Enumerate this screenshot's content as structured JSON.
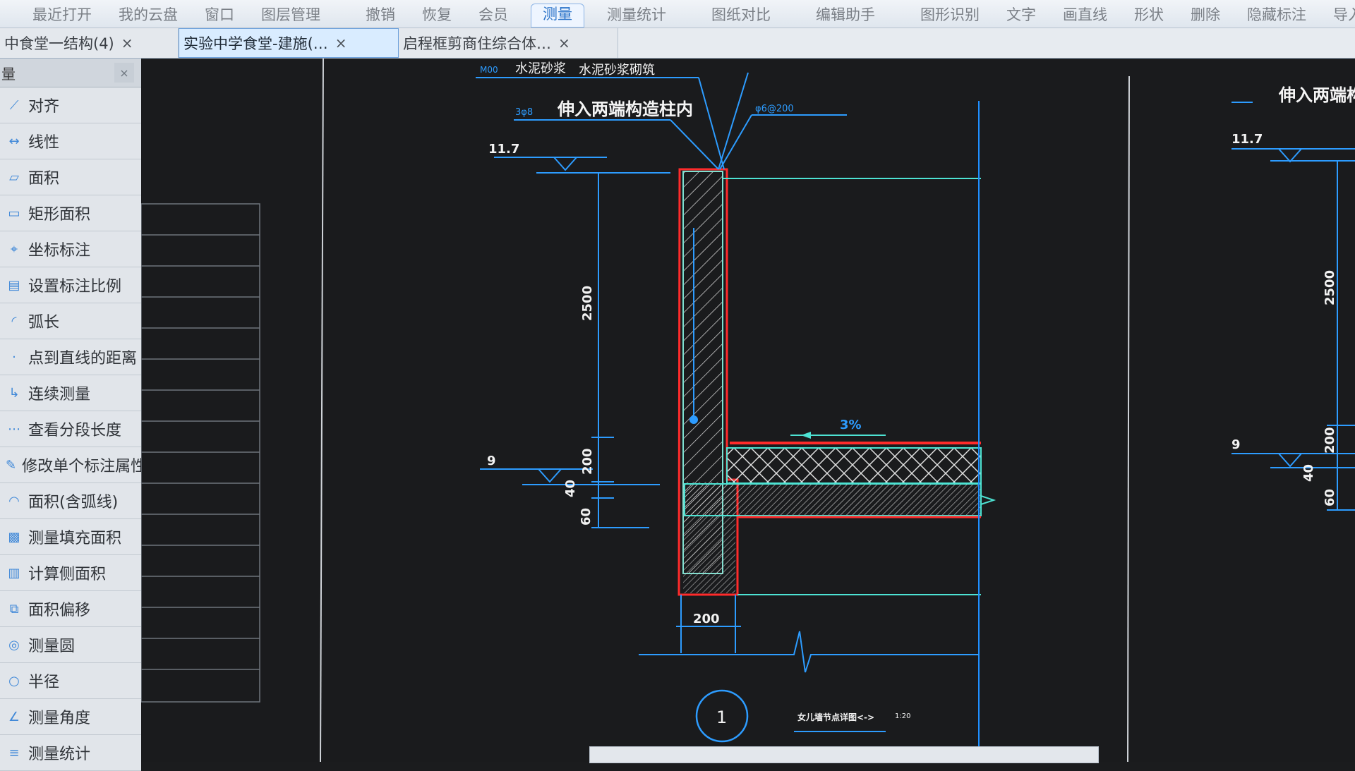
{
  "toolbar": {
    "items": [
      "最近打开",
      "我的云盘",
      "窗口",
      "图层管理",
      "撤销",
      "恢复",
      "会员",
      "测量",
      "测量统计",
      "图纸对比",
      "编辑助手",
      "图形识别",
      "文字",
      "画直线",
      "形状",
      "删除",
      "隐藏标注",
      "导入导"
    ],
    "active_index": 7
  },
  "tabs": [
    {
      "label": "中食堂一结构(4)",
      "close": "×"
    },
    {
      "label": "实验中学食堂-建施(…",
      "close": "×"
    },
    {
      "label": "启程框剪商住综合体…",
      "close": "×"
    }
  ],
  "active_tab": 1,
  "sidebar": {
    "title": "量",
    "close": "×",
    "items": [
      {
        "label": "对齐",
        "icon": "align-icon"
      },
      {
        "label": "线性",
        "icon": "linear-icon"
      },
      {
        "label": "面积",
        "icon": "area-icon"
      },
      {
        "label": "矩形面积",
        "icon": "rect-area-icon"
      },
      {
        "label": "坐标标注",
        "icon": "coordinate-icon"
      },
      {
        "label": "设置标注比例",
        "icon": "scale-icon"
      },
      {
        "label": "弧长",
        "icon": "arc-icon"
      },
      {
        "label": "点到直线的距离",
        "icon": "distance-icon"
      },
      {
        "label": "连续测量",
        "icon": "continuous-icon"
      },
      {
        "label": "查看分段长度",
        "icon": "segment-icon"
      },
      {
        "label": "修改单个标注属性",
        "icon": "edit-icon"
      },
      {
        "label": "面积(含弧线)",
        "icon": "arc-area-icon"
      },
      {
        "label": "测量填充面积",
        "icon": "fill-icon"
      },
      {
        "label": "计算侧面积",
        "icon": "side-area-icon"
      },
      {
        "label": "面积偏移",
        "icon": "offset-icon"
      },
      {
        "label": "测量圆",
        "icon": "circle-icon"
      },
      {
        "label": "半径",
        "icon": "radius-icon"
      },
      {
        "label": "测量角度",
        "icon": "angle-icon"
      },
      {
        "label": "测量统计",
        "icon": "stats-icon"
      }
    ]
  },
  "drawing": {
    "labels": {
      "top_note1": "水泥砂浆",
      "top_note2": "M00",
      "top_note3": "水泥砂浆砌筑",
      "note_main": "伸入两端构造柱内",
      "note_left": "3φ8",
      "note_right": "φ6@200",
      "elev_top": "11.7",
      "elev_bottom": "9",
      "dim_2500": "2500",
      "dim_200": "200",
      "dim_40": "40",
      "dim_60": "60",
      "slope": "3%",
      "bottom_dim": "200",
      "circle_no": "1",
      "footnote": "女儿墙节点详图<->",
      "footnote_scale": "1:20",
      "right_note": "伸入两端构造",
      "right_elev_top": "11.7",
      "right_elev_bottom": "9",
      "right_dim_2500": "2500",
      "right_dim_200": "200",
      "right_dim_40": "40",
      "right_dim_60": "60"
    }
  }
}
